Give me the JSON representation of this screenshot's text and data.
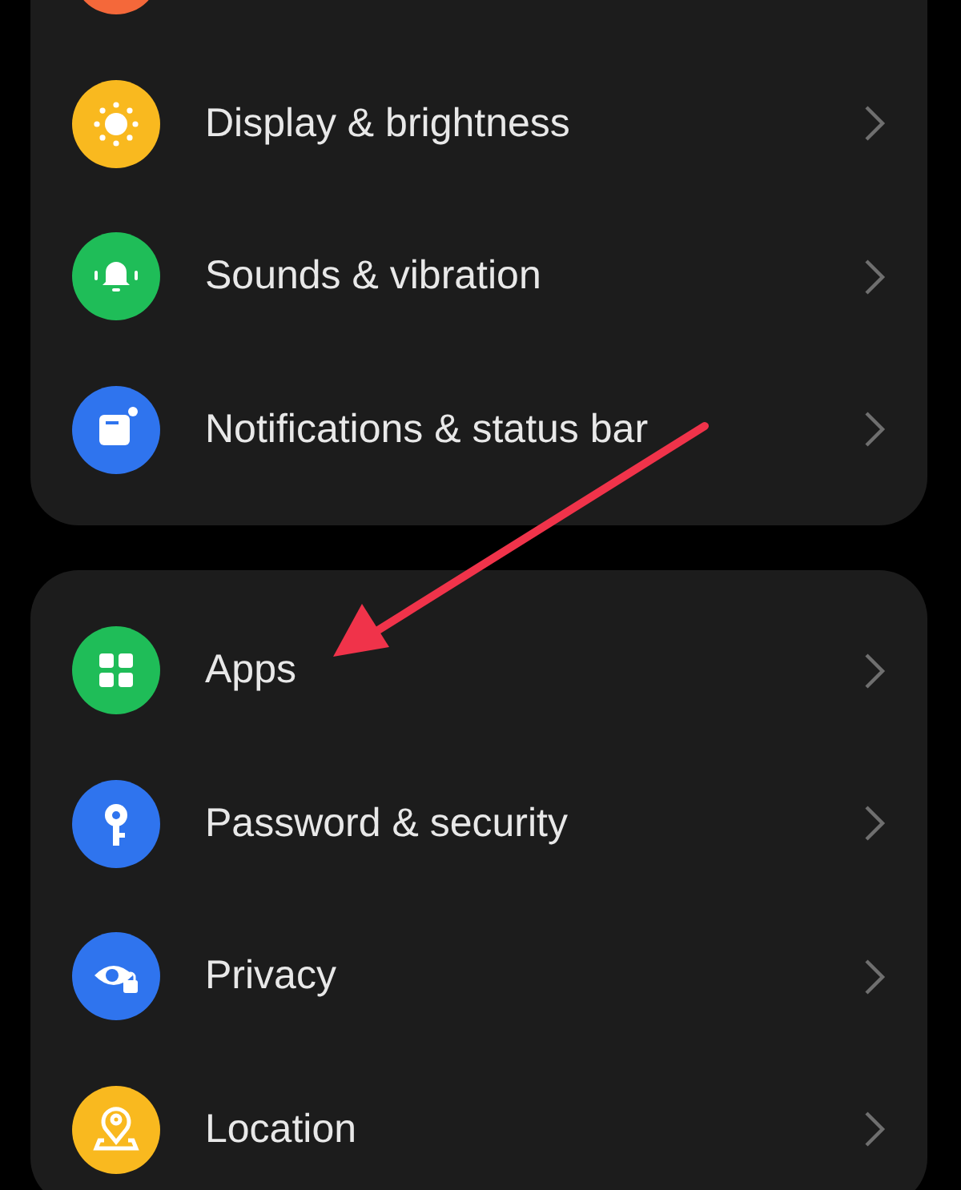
{
  "groups": [
    {
      "items": [
        {
          "kind": "partial",
          "color": "#f4683a"
        },
        {
          "kind": "sun",
          "label": "Display & brightness",
          "color": "#f9b91f"
        },
        {
          "kind": "bell",
          "label": "Sounds & vibration",
          "color": "#1fbd58"
        },
        {
          "kind": "notification",
          "label": "Notifications & status bar",
          "color": "#2f74ee"
        }
      ]
    },
    {
      "items": [
        {
          "kind": "grid",
          "label": "Apps",
          "color": "#1fbd58"
        },
        {
          "kind": "key",
          "label": "Password & security",
          "color": "#2f74ee"
        },
        {
          "kind": "eye",
          "label": "Privacy",
          "color": "#2f74ee"
        },
        {
          "kind": "pin",
          "label": "Location",
          "color": "#f9b91f"
        }
      ]
    }
  ]
}
